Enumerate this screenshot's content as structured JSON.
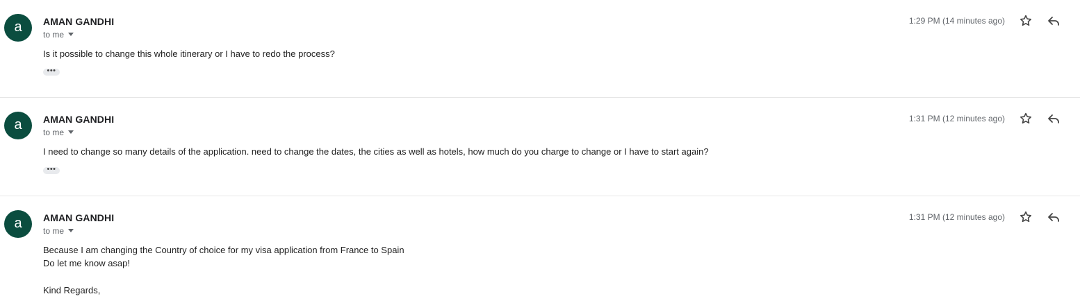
{
  "messages": [
    {
      "avatar_letter": "a",
      "sender": "AMAN GANDHI",
      "to": "to me",
      "time": "1:29 PM (14 minutes ago)",
      "body": [
        "Is it possible to change this whole itinerary or I have to redo the process?"
      ]
    },
    {
      "avatar_letter": "a",
      "sender": "AMAN GANDHI",
      "to": "to me",
      "time": "1:31 PM (12 minutes ago)",
      "body": [
        "I need to change so many details of the application. need to change the dates, the cities as well as hotels, how much do you charge to change or I have to start again?"
      ]
    },
    {
      "avatar_letter": "a",
      "sender": "AMAN GANDHI",
      "to": "to me",
      "time": "1:31 PM (12 minutes ago)",
      "body": [
        "Because I am changing the Country of choice for my visa application from France to Spain",
        "Do let me know asap!",
        "",
        "Kind Regards,"
      ]
    }
  ],
  "icons": {
    "star": "star-icon",
    "reply": "reply-icon",
    "more": "more-icon",
    "caret": "chevron-down-icon"
  },
  "colors": {
    "avatar_bg": "#0b4d3f"
  }
}
